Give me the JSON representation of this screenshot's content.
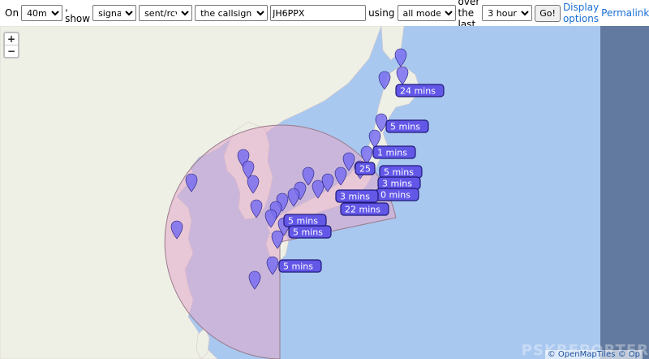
{
  "controls": {
    "on_label": "On",
    "band_value": "40m",
    "show_label": ", show",
    "show_value": "signals",
    "direction_value": "sent/rcvd by",
    "target_value": "the callsign",
    "callsign_value": "JH6PPX",
    "using_label": "using",
    "mode_value": "all modes",
    "over_label": "over the last",
    "period_value": "3 hours",
    "go_label": "Go!",
    "display_options_label": "Display options",
    "permalink_label": "Permalink"
  },
  "map": {
    "zoom_in": "+",
    "zoom_out": "−",
    "attribution": "© OpenMapTiles © Op",
    "watermark": "PSKREPORTER",
    "colors": {
      "sea": "#a9c8f0",
      "land": "#eef0e6",
      "range": "#e4a7c8",
      "marker": "#7a6ef0",
      "label_bg": "#6357e8",
      "label_border": "#1f1a78"
    }
  },
  "spot_labels": [
    {
      "text": "24 mins"
    },
    {
      "text": "5 mins"
    },
    {
      "text": "1 mins"
    },
    {
      "text": "5 mins"
    },
    {
      "text": "3 mins"
    },
    {
      "text": "0 mins"
    },
    {
      "text": "25"
    },
    {
      "text": "3 mins"
    },
    {
      "text": "22 mins"
    },
    {
      "text": "5 mins"
    },
    {
      "text": "5 mins"
    },
    {
      "text": "5 mins"
    }
  ]
}
